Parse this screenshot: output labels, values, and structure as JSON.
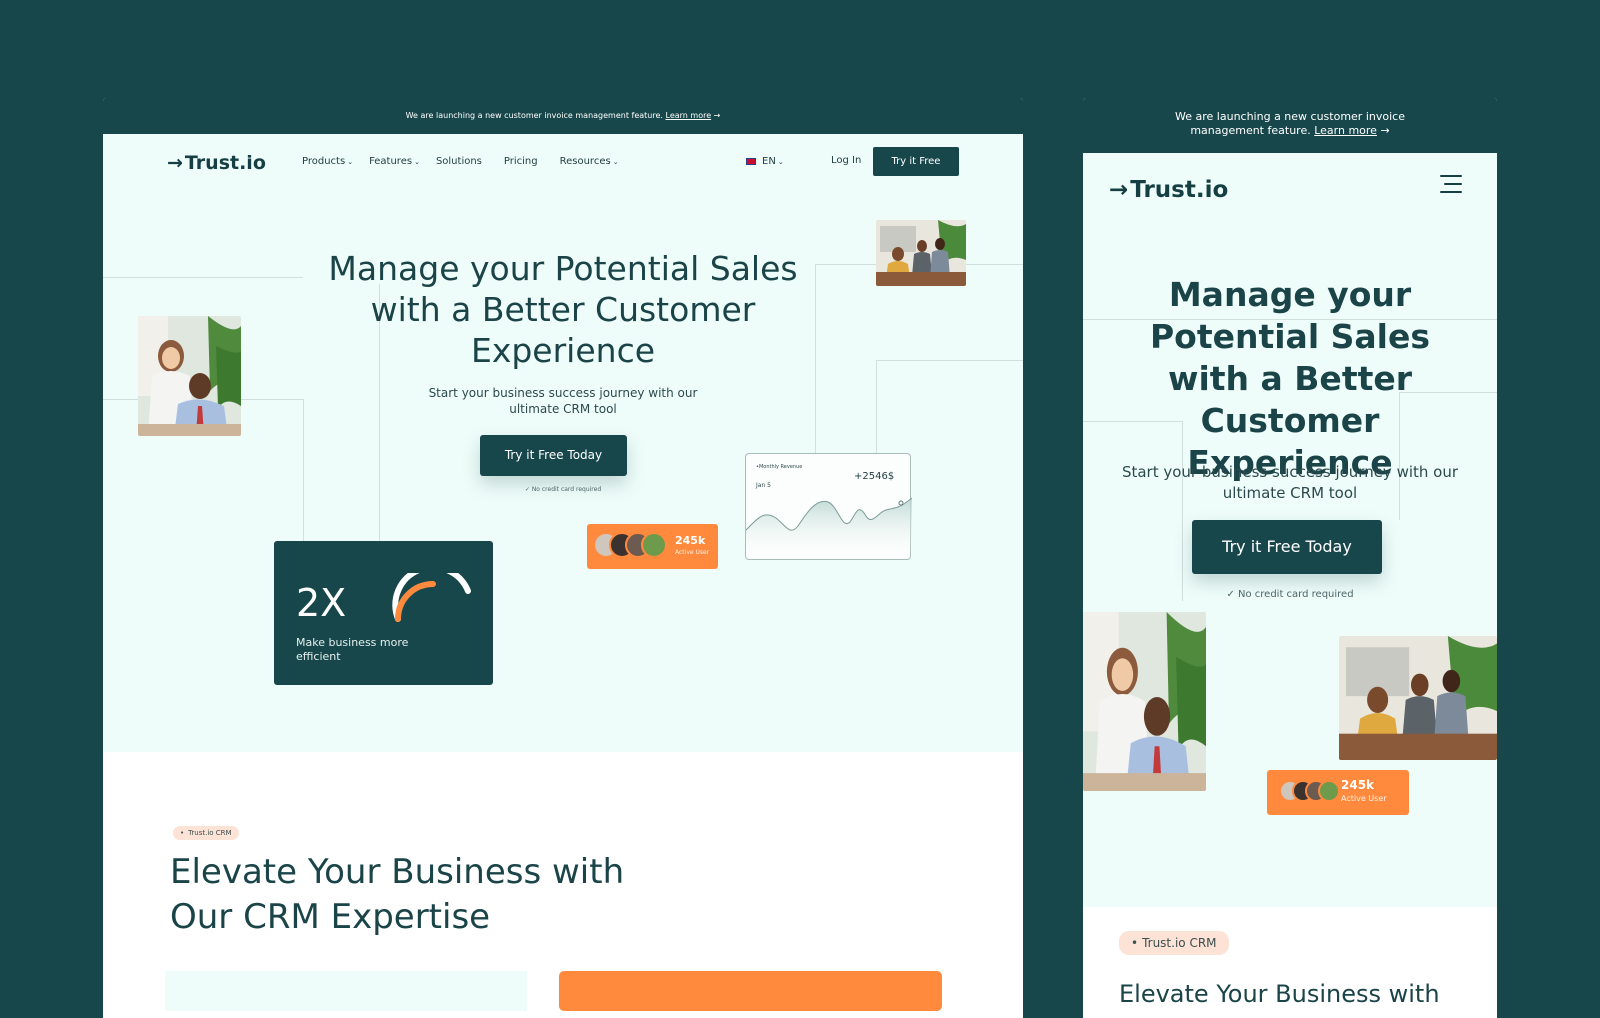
{
  "banner": {
    "text": "We are launching a new customer invoice management feature.",
    "link": "Learn more",
    "arrow": "→"
  },
  "brand": {
    "name": "Trust.io",
    "arrow": "→"
  },
  "nav": {
    "items": [
      {
        "label": "Products",
        "dropdown": true
      },
      {
        "label": "Features",
        "dropdown": true
      },
      {
        "label": "Solutions",
        "dropdown": false
      },
      {
        "label": "Pricing",
        "dropdown": false
      },
      {
        "label": "Resources",
        "dropdown": true
      }
    ],
    "language": "EN",
    "login": "Log In",
    "cta": "Try it Free"
  },
  "hero": {
    "title": "Manage your Potential Sales with a Better Customer Experience",
    "subtitle": "Start your business success journey with our ultimate CRM tool",
    "cta": "Try it Free Today",
    "note_check": "✓",
    "note_desktop": "No credit card required",
    "note_mobile": "No credit card required"
  },
  "stat_card": {
    "value": "2X",
    "label": "Make business more efficient",
    "gauge_fraction": 0.5
  },
  "users_pill": {
    "count": "245k",
    "label": "Active User"
  },
  "revenue_card": {
    "label": "•Monthly Revenue",
    "date": "Jan 5",
    "value": "+2546$"
  },
  "section": {
    "tag": "Trust.io CRM",
    "title": "Elevate Your Business with Our CRM Expertise",
    "title_mobile": "Elevate Your Business with"
  },
  "colors": {
    "primary": "#18474b",
    "hero_bg": "#effdfa",
    "accent": "#ff8a3d",
    "tag_bg": "#fde3d6"
  },
  "icons": {
    "menu": "hamburger-icon",
    "dropdown": "chevron-down-icon",
    "flag": "uk-flag-icon",
    "check": "check-icon"
  }
}
